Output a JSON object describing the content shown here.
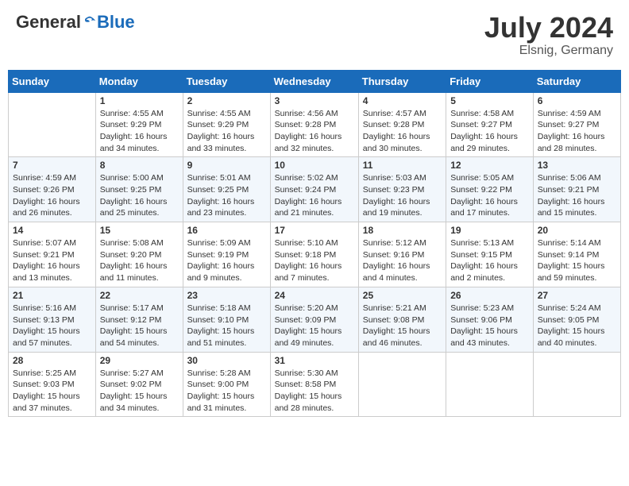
{
  "header": {
    "logo_general": "General",
    "logo_blue": "Blue",
    "month_title": "July 2024",
    "location": "Elsnig, Germany"
  },
  "calendar": {
    "columns": [
      "Sunday",
      "Monday",
      "Tuesday",
      "Wednesday",
      "Thursday",
      "Friday",
      "Saturday"
    ],
    "weeks": [
      [
        {
          "day": "",
          "info": ""
        },
        {
          "day": "1",
          "info": "Sunrise: 4:55 AM\nSunset: 9:29 PM\nDaylight: 16 hours\nand 34 minutes."
        },
        {
          "day": "2",
          "info": "Sunrise: 4:55 AM\nSunset: 9:29 PM\nDaylight: 16 hours\nand 33 minutes."
        },
        {
          "day": "3",
          "info": "Sunrise: 4:56 AM\nSunset: 9:28 PM\nDaylight: 16 hours\nand 32 minutes."
        },
        {
          "day": "4",
          "info": "Sunrise: 4:57 AM\nSunset: 9:28 PM\nDaylight: 16 hours\nand 30 minutes."
        },
        {
          "day": "5",
          "info": "Sunrise: 4:58 AM\nSunset: 9:27 PM\nDaylight: 16 hours\nand 29 minutes."
        },
        {
          "day": "6",
          "info": "Sunrise: 4:59 AM\nSunset: 9:27 PM\nDaylight: 16 hours\nand 28 minutes."
        }
      ],
      [
        {
          "day": "7",
          "info": "Sunrise: 4:59 AM\nSunset: 9:26 PM\nDaylight: 16 hours\nand 26 minutes."
        },
        {
          "day": "8",
          "info": "Sunrise: 5:00 AM\nSunset: 9:25 PM\nDaylight: 16 hours\nand 25 minutes."
        },
        {
          "day": "9",
          "info": "Sunrise: 5:01 AM\nSunset: 9:25 PM\nDaylight: 16 hours\nand 23 minutes."
        },
        {
          "day": "10",
          "info": "Sunrise: 5:02 AM\nSunset: 9:24 PM\nDaylight: 16 hours\nand 21 minutes."
        },
        {
          "day": "11",
          "info": "Sunrise: 5:03 AM\nSunset: 9:23 PM\nDaylight: 16 hours\nand 19 minutes."
        },
        {
          "day": "12",
          "info": "Sunrise: 5:05 AM\nSunset: 9:22 PM\nDaylight: 16 hours\nand 17 minutes."
        },
        {
          "day": "13",
          "info": "Sunrise: 5:06 AM\nSunset: 9:21 PM\nDaylight: 16 hours\nand 15 minutes."
        }
      ],
      [
        {
          "day": "14",
          "info": "Sunrise: 5:07 AM\nSunset: 9:21 PM\nDaylight: 16 hours\nand 13 minutes."
        },
        {
          "day": "15",
          "info": "Sunrise: 5:08 AM\nSunset: 9:20 PM\nDaylight: 16 hours\nand 11 minutes."
        },
        {
          "day": "16",
          "info": "Sunrise: 5:09 AM\nSunset: 9:19 PM\nDaylight: 16 hours\nand 9 minutes."
        },
        {
          "day": "17",
          "info": "Sunrise: 5:10 AM\nSunset: 9:18 PM\nDaylight: 16 hours\nand 7 minutes."
        },
        {
          "day": "18",
          "info": "Sunrise: 5:12 AM\nSunset: 9:16 PM\nDaylight: 16 hours\nand 4 minutes."
        },
        {
          "day": "19",
          "info": "Sunrise: 5:13 AM\nSunset: 9:15 PM\nDaylight: 16 hours\nand 2 minutes."
        },
        {
          "day": "20",
          "info": "Sunrise: 5:14 AM\nSunset: 9:14 PM\nDaylight: 15 hours\nand 59 minutes."
        }
      ],
      [
        {
          "day": "21",
          "info": "Sunrise: 5:16 AM\nSunset: 9:13 PM\nDaylight: 15 hours\nand 57 minutes."
        },
        {
          "day": "22",
          "info": "Sunrise: 5:17 AM\nSunset: 9:12 PM\nDaylight: 15 hours\nand 54 minutes."
        },
        {
          "day": "23",
          "info": "Sunrise: 5:18 AM\nSunset: 9:10 PM\nDaylight: 15 hours\nand 51 minutes."
        },
        {
          "day": "24",
          "info": "Sunrise: 5:20 AM\nSunset: 9:09 PM\nDaylight: 15 hours\nand 49 minutes."
        },
        {
          "day": "25",
          "info": "Sunrise: 5:21 AM\nSunset: 9:08 PM\nDaylight: 15 hours\nand 46 minutes."
        },
        {
          "day": "26",
          "info": "Sunrise: 5:23 AM\nSunset: 9:06 PM\nDaylight: 15 hours\nand 43 minutes."
        },
        {
          "day": "27",
          "info": "Sunrise: 5:24 AM\nSunset: 9:05 PM\nDaylight: 15 hours\nand 40 minutes."
        }
      ],
      [
        {
          "day": "28",
          "info": "Sunrise: 5:25 AM\nSunset: 9:03 PM\nDaylight: 15 hours\nand 37 minutes."
        },
        {
          "day": "29",
          "info": "Sunrise: 5:27 AM\nSunset: 9:02 PM\nDaylight: 15 hours\nand 34 minutes."
        },
        {
          "day": "30",
          "info": "Sunrise: 5:28 AM\nSunset: 9:00 PM\nDaylight: 15 hours\nand 31 minutes."
        },
        {
          "day": "31",
          "info": "Sunrise: 5:30 AM\nSunset: 8:58 PM\nDaylight: 15 hours\nand 28 minutes."
        },
        {
          "day": "",
          "info": ""
        },
        {
          "day": "",
          "info": ""
        },
        {
          "day": "",
          "info": ""
        }
      ]
    ]
  }
}
